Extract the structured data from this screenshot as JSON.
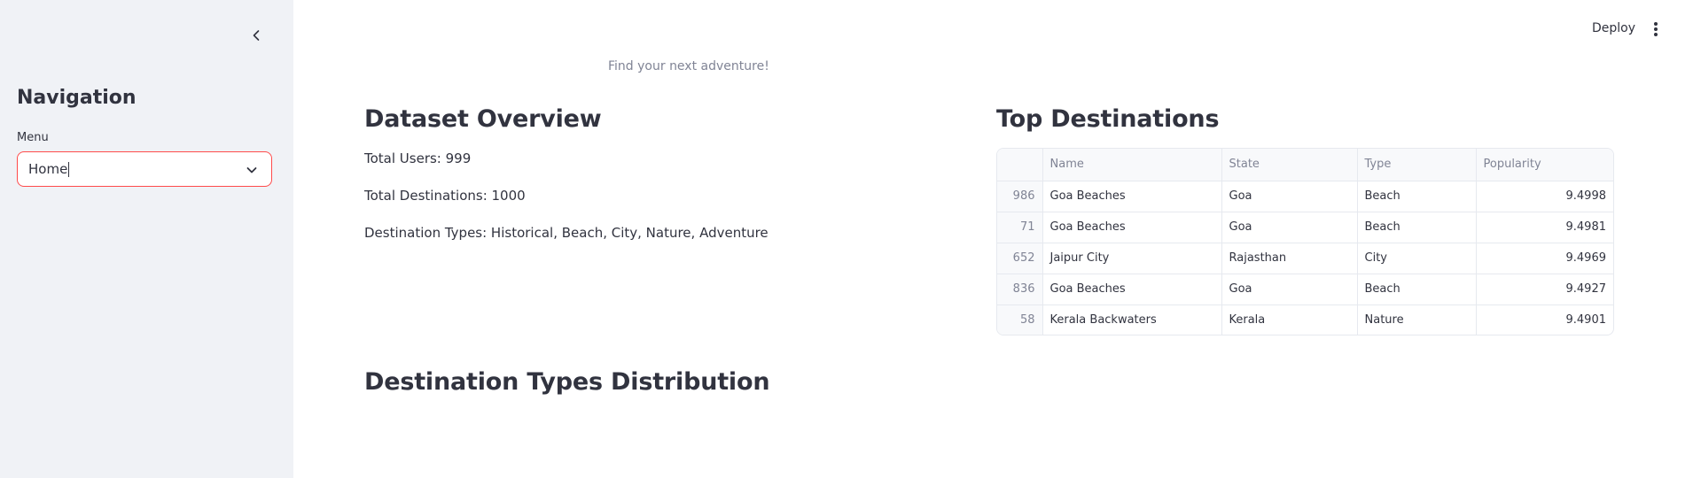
{
  "sidebar": {
    "title": "Navigation",
    "menu_label": "Menu",
    "menu_value": "Home"
  },
  "header": {
    "deploy_label": "Deploy"
  },
  "main": {
    "tagline": "Find your next adventure!",
    "overview": {
      "title": "Dataset Overview",
      "total_users": "Total Users: 999",
      "total_destinations": "Total Destinations: 1000",
      "destination_types": "Destination Types: Historical, Beach, City, Nature, Adventure"
    },
    "top_destinations": {
      "title": "Top Destinations",
      "columns": [
        "",
        "Name",
        "State",
        "Type",
        "Popularity"
      ],
      "rows": [
        {
          "index": "986",
          "name": "Goa Beaches",
          "state": "Goa",
          "type": "Beach",
          "popularity": "9.4998"
        },
        {
          "index": "71",
          "name": "Goa Beaches",
          "state": "Goa",
          "type": "Beach",
          "popularity": "9.4981"
        },
        {
          "index": "652",
          "name": "Jaipur City",
          "state": "Rajasthan",
          "type": "City",
          "popularity": "9.4969"
        },
        {
          "index": "836",
          "name": "Goa Beaches",
          "state": "Goa",
          "type": "Beach",
          "popularity": "9.4927"
        },
        {
          "index": "58",
          "name": "Kerala Backwaters",
          "state": "Kerala",
          "type": "Nature",
          "popularity": "9.4901"
        }
      ]
    },
    "distribution_title": "Destination Types Distribution"
  },
  "colors": {
    "sidebar_bg": "#f0f2f6",
    "accent": "#ff4b4b",
    "text": "#31333f",
    "muted": "#808495"
  },
  "icons": [
    "chevron-left-icon",
    "chevron-down-icon",
    "kebab-menu-icon"
  ]
}
